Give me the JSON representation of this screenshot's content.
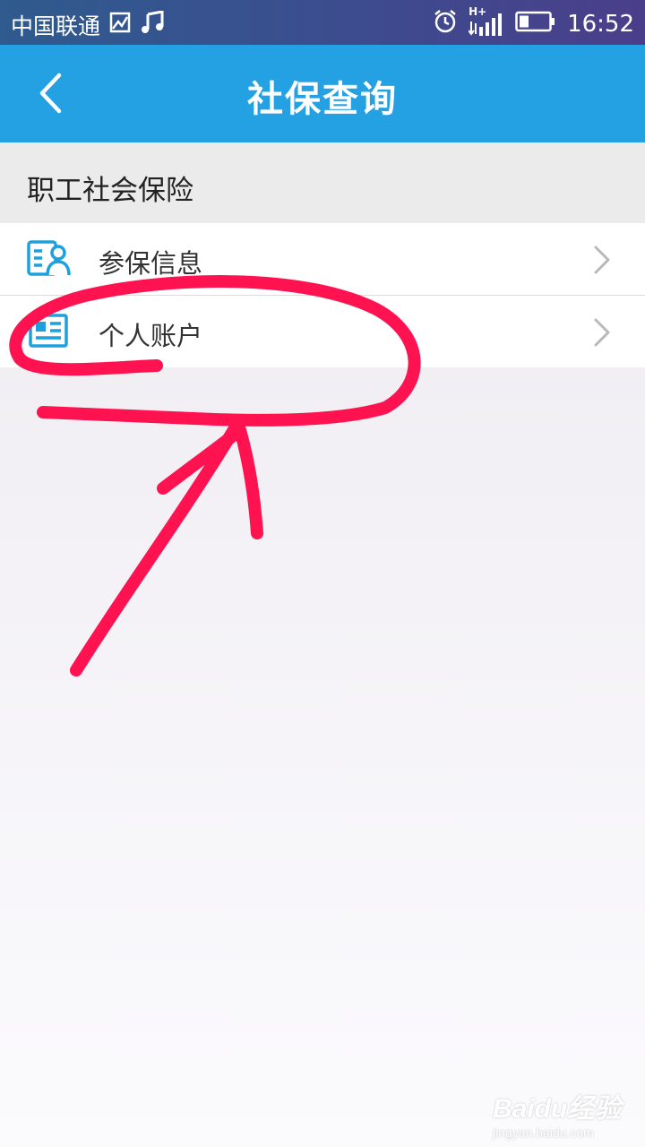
{
  "status_bar": {
    "carrier": "中国联通",
    "network_type": "H+",
    "time": "16:52"
  },
  "header": {
    "title": "社保查询"
  },
  "section": {
    "title": "职工社会保险"
  },
  "menu": {
    "items": [
      {
        "label": "参保信息",
        "icon": "insurance-info-icon"
      },
      {
        "label": "个人账户",
        "icon": "personal-account-icon"
      }
    ]
  },
  "watermark": {
    "brand": "Baidu经验",
    "url": "jingyan.baidu.com"
  },
  "colors": {
    "app_bar": "#23a1e2",
    "icon_accent": "#1ea0dc",
    "annotation": "#ff1250"
  }
}
